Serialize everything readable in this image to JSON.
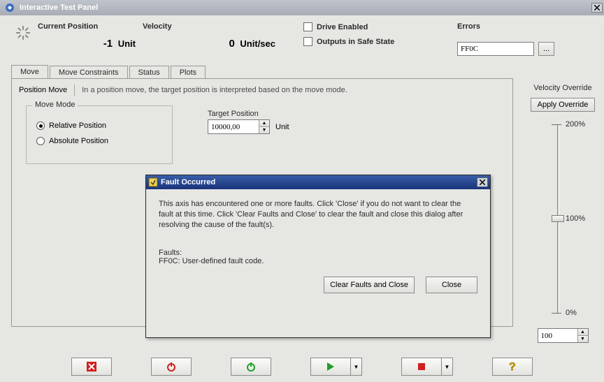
{
  "window": {
    "title": "Interactive Test Panel"
  },
  "status": {
    "position_label": "Current Position",
    "position_value": "-1",
    "position_unit": "Unit",
    "velocity_label": "Velocity",
    "velocity_value": "0",
    "velocity_unit": "Unit/sec",
    "drive_enabled_label": "Drive Enabled",
    "safe_state_label": "Outputs in Safe State",
    "errors_label": "Errors",
    "errors_value": "FF0C",
    "errors_more": "..."
  },
  "tabs": [
    {
      "label": "Move"
    },
    {
      "label": "Move Constraints"
    },
    {
      "label": "Status"
    },
    {
      "label": "Plots"
    }
  ],
  "move_pane": {
    "title": "Position Move",
    "desc": "In a position move, the target position is interpreted based on the move mode.",
    "fieldset_legend": "Move Mode",
    "radio_relative": "Relative Position",
    "radio_absolute": "Absolute Position",
    "target_label": "Target Position",
    "target_value": "10000,00",
    "target_unit": "Unit"
  },
  "override": {
    "title": "Velocity Override",
    "apply_label": "Apply Override",
    "tick_200": "200%",
    "tick_100": "100%",
    "tick_0": "0%",
    "value": "100"
  },
  "dialog": {
    "title": "Fault Occurred",
    "body": "This axis has encountered one or more faults. Click 'Close' if you do not want to clear the fault at this time.  Click 'Clear Faults and Close' to clear the fault and close this dialog after resolving the cause of the fault(s).",
    "faults_header": "Faults:",
    "faults_line": "FF0C: User-defined fault code.",
    "btn_clear": "Clear Faults and Close",
    "btn_close": "Close"
  }
}
